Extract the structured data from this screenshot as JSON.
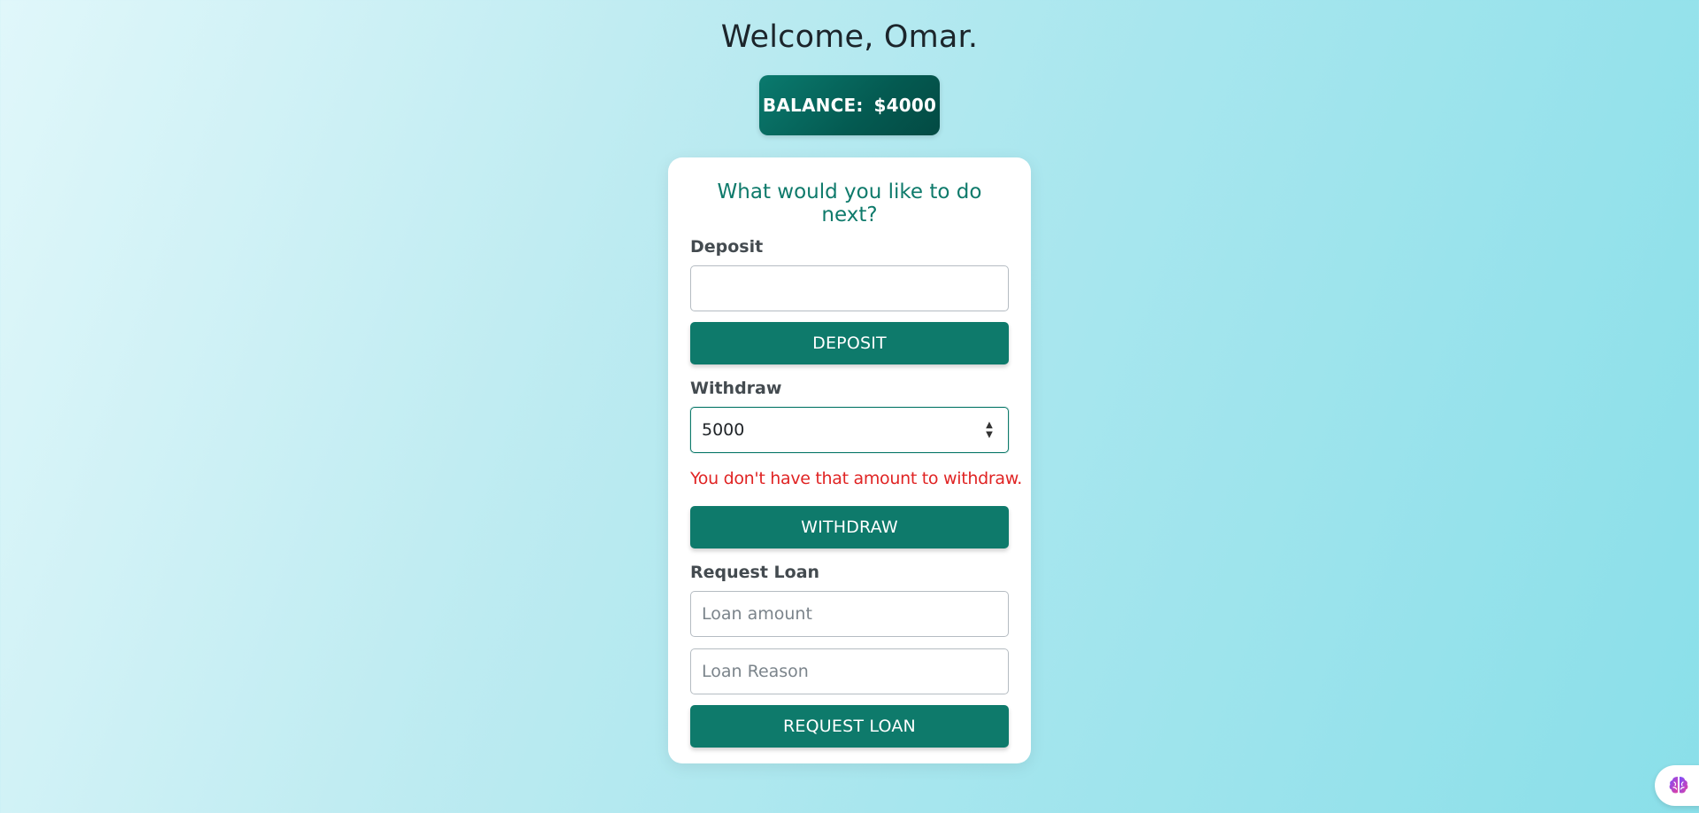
{
  "header": {
    "welcome": "Welcome, Omar.",
    "balance_label": "BALANCE:",
    "balance_value": "$4000"
  },
  "card": {
    "heading": "What would you like to do next?",
    "deposit": {
      "label": "Deposit",
      "value": "",
      "button": "DEPOSIT"
    },
    "withdraw": {
      "label": "Withdraw",
      "value": "5000",
      "error": "You don't have that amount to withdraw.",
      "button": "WITHDRAW"
    },
    "loan": {
      "label": "Request Loan",
      "amount_placeholder": "Loan amount",
      "reason_placeholder": "Loan Reason",
      "button": "REQUEST LOAN"
    }
  },
  "colors": {
    "accent": "#0e7a6b",
    "error": "#e02424"
  },
  "icons": {
    "spinner_up": "spinner-up-icon",
    "spinner_down": "spinner-down-icon",
    "assistant": "brain-icon"
  }
}
